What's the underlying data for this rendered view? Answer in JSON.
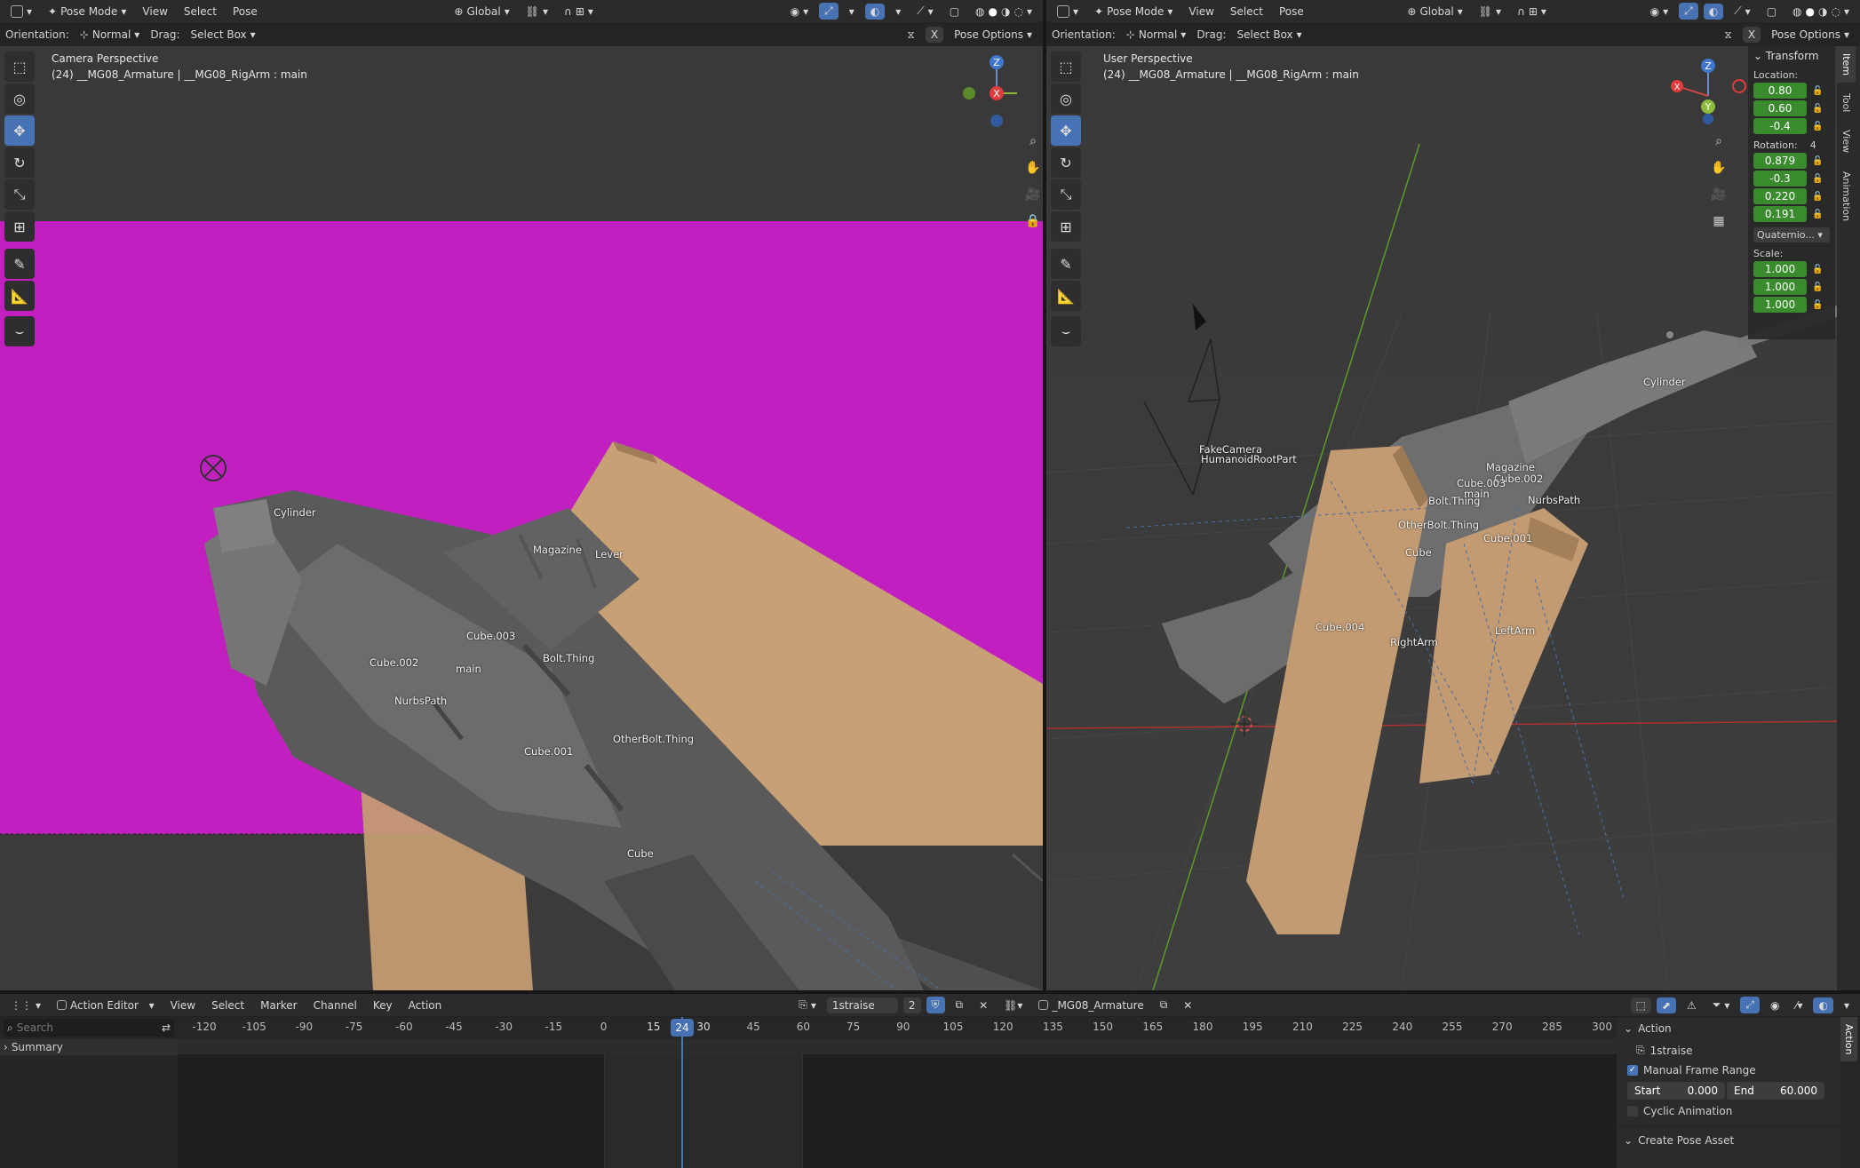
{
  "left": {
    "header": {
      "mode": "Pose Mode",
      "menus": [
        "View",
        "Select",
        "Pose"
      ],
      "orient_space": "Global"
    },
    "sub": {
      "orientation_label": "Orientation:",
      "orientation": "Normal",
      "drag_label": "Drag:",
      "drag": "Select Box",
      "pose_options": "Pose Options"
    },
    "overlay": {
      "title": "Camera Perspective",
      "subtitle": "(24) __MG08_Armature | __MG08_RigArm : main"
    },
    "bones": [
      "Cylinder",
      "Magazine",
      "Lever",
      "Cube.003",
      "Cube.002",
      "main",
      "Bolt.Thing",
      "NurbsPath",
      "Cube.001",
      "OtherBolt.Thing",
      "Cube"
    ]
  },
  "right": {
    "header": {
      "mode": "Pose Mode",
      "menus": [
        "View",
        "Select",
        "Pose"
      ],
      "orient_space": "Global"
    },
    "sub": {
      "orientation_label": "Orientation:",
      "orientation": "Normal",
      "drag_label": "Drag:",
      "drag": "Select Box",
      "pose_options": "Pose Options"
    },
    "overlay": {
      "title": "User Perspective",
      "subtitle": "(24) __MG08_Armature | __MG08_RigArm : main"
    },
    "bones": [
      "Cylinder",
      "FakeCamera",
      "HumanoidRootPart",
      "Magazine",
      "Cube.002",
      "Cube.003",
      "main",
      "Bolt.Thing",
      "NurbsPath",
      "OtherBolt.Thing",
      "Cube.001",
      "Cube",
      "Cube.004",
      "RightArm",
      "LeftArm"
    ],
    "panel": {
      "title": "Transform",
      "location_label": "Location:",
      "location": [
        "0.80",
        "0.60",
        "-0.4"
      ],
      "rotation_label": "Rotation:",
      "rotation_extra": "4",
      "rotation": [
        "0.879",
        "-0.3",
        "0.220",
        "0.191"
      ],
      "rotation_mode": "Quaternio...",
      "scale_label": "Scale:",
      "scale": [
        "1.000",
        "1.000",
        "1.000"
      ]
    },
    "side_tabs": [
      "Item",
      "Tool",
      "View",
      "Animation"
    ]
  },
  "timeline": {
    "editor": "Action Editor",
    "menus": [
      "View",
      "Select",
      "Marker",
      "Channel",
      "Key",
      "Action"
    ],
    "action_name": "1straise",
    "users": "2",
    "object": "_MG08_Armature",
    "search_placeholder": "Search",
    "summary": "Summary",
    "ticks": [
      "-120",
      "-105",
      "-90",
      "-75",
      "-60",
      "-45",
      "-30",
      "-15",
      "0",
      "15",
      "30",
      "45",
      "60",
      "75",
      "90",
      "105",
      "120",
      "135",
      "150",
      "165",
      "180",
      "195",
      "210",
      "225",
      "240",
      "255",
      "270",
      "285",
      "300"
    ],
    "current_frame": "24",
    "sidebar": {
      "section": "Action",
      "action_name": "1straise",
      "manual_range": "Manual Frame Range",
      "start_label": "Start",
      "start": "0.000",
      "end_label": "End",
      "end": "60.000",
      "cyclic": "Cyclic Animation",
      "create_pose": "Create Pose Asset",
      "tab": "Action"
    }
  },
  "colors": {
    "accent": "#4772b3",
    "magenta": "#c21fc0",
    "field_green": "#3a8a2e",
    "cube": "#c39b72"
  }
}
